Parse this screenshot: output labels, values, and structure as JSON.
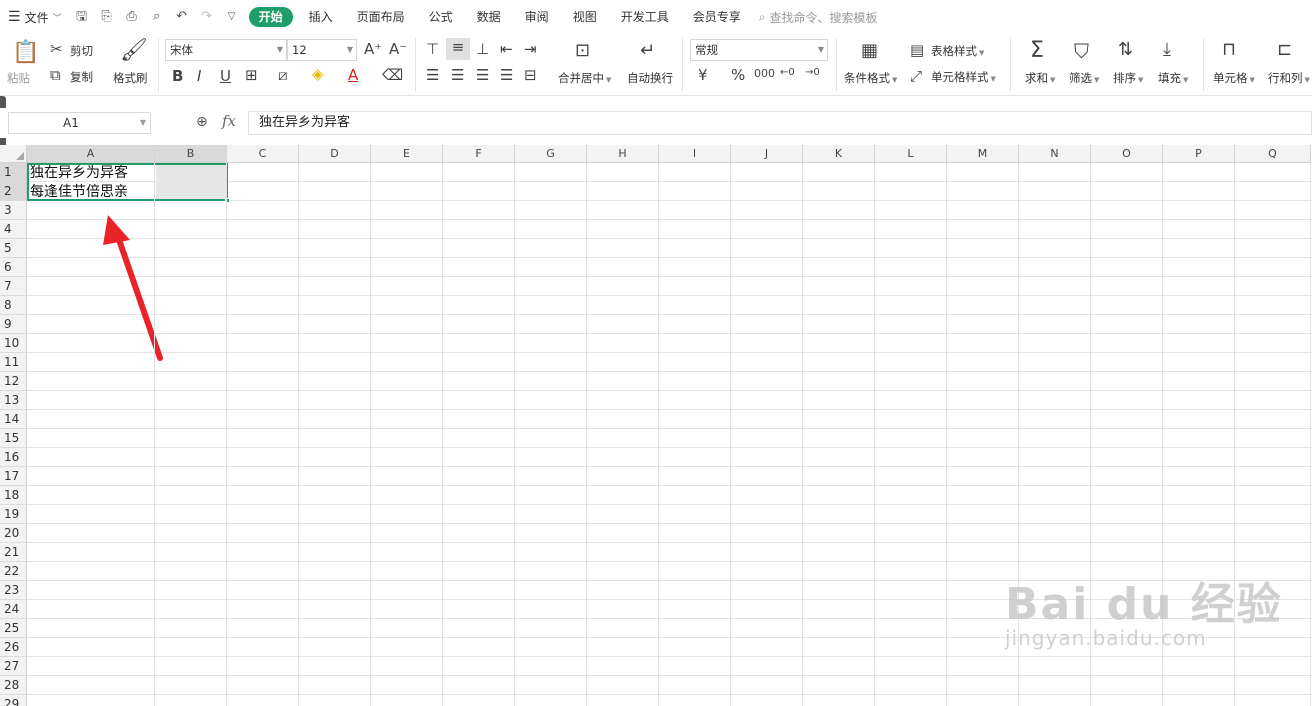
{
  "menubar": {
    "file_label": "文件",
    "tabs": [
      "开始",
      "插入",
      "页面布局",
      "公式",
      "数据",
      "审阅",
      "视图",
      "开发工具",
      "会员专享"
    ],
    "active_tab": "开始",
    "search_text": "查找命令、搜索模板"
  },
  "ribbon": {
    "paste": "粘贴",
    "cut": "剪切",
    "copy": "复制",
    "format_painter": "格式刷",
    "font_name": "宋体",
    "font_size": "12",
    "merge_center": "合并居中",
    "wrap_text": "自动换行",
    "number_format": "常规",
    "table_style": "表格样式",
    "cond_format": "条件格式",
    "cell_style": "单元格样式",
    "sum": "求和",
    "filter": "筛选",
    "sort": "排序",
    "fill": "填充",
    "cell": "单元格",
    "row_col": "行和列"
  },
  "formula_bar": {
    "name_box": "A1",
    "fx_label": "fx",
    "content": "独在异乡为异客"
  },
  "sheet": {
    "columns": [
      "A",
      "B",
      "C",
      "D",
      "E",
      "F",
      "G",
      "H",
      "I",
      "J",
      "K",
      "L",
      "M",
      "N",
      "O",
      "P",
      "Q"
    ],
    "rows": [
      "1",
      "2",
      "3",
      "4",
      "5",
      "6",
      "7",
      "8",
      "9",
      "10",
      "11",
      "12",
      "13",
      "14",
      "15",
      "16",
      "17",
      "18",
      "19",
      "20",
      "21",
      "22",
      "23",
      "24",
      "25",
      "26",
      "27",
      "28",
      "29"
    ],
    "cells": {
      "A1": "独在异乡为异客",
      "A2": "每逢佳节倍思亲"
    },
    "selection": "A1:B2"
  },
  "watermark": {
    "brand": "Bai du 经验",
    "url": "jingyan.baidu.com"
  },
  "colors": {
    "accent": "#1f9e6b",
    "arrow": "#e8232a"
  }
}
